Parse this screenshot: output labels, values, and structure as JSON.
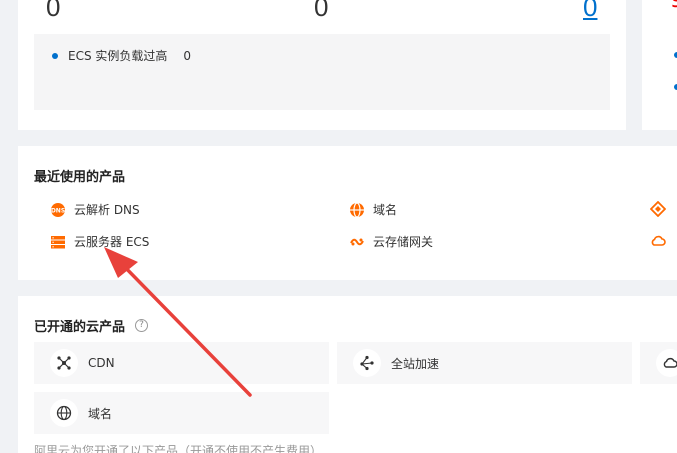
{
  "stats": {
    "values": [
      "0",
      "0",
      "0"
    ],
    "alert": {
      "label": "ECS 实例负载过高",
      "count": "0"
    }
  },
  "recent": {
    "title": "最近使用的产品",
    "items": [
      {
        "label": "云解析 DNS",
        "icon": "dns-icon"
      },
      {
        "label": "域名",
        "icon": "globe-icon"
      },
      {
        "label": "云服务器 ECS",
        "icon": "server-icon"
      },
      {
        "label": "云存储网关",
        "icon": "storage-gateway-icon"
      }
    ]
  },
  "opened": {
    "title": "已开通的云产品",
    "help": "?",
    "tiles": [
      {
        "label": "CDN",
        "icon": "cdn-icon"
      },
      {
        "label": "全站加速",
        "icon": "acceleration-icon"
      },
      {
        "label": "域名",
        "icon": "globe-icon"
      }
    ],
    "footnote": "阿里云为您开通了以下产品（开通不使用不产生费用）"
  },
  "colors": {
    "accent": "#0070cc",
    "icon_orange": "#ff6a00",
    "annotation_red": "#e8413b"
  }
}
